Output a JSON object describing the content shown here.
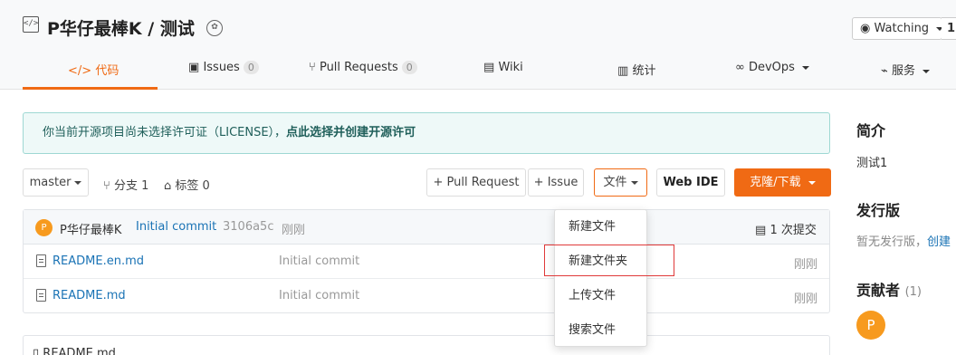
{
  "header": {
    "repo_title": "P华仔最棒K / 测试",
    "watch_label": "Watching",
    "watch_count": "1",
    "tabs": [
      {
        "icon": "</>",
        "label": "代码"
      },
      {
        "label": "Issues",
        "count": "0"
      },
      {
        "label": "Pull Requests",
        "count": "0"
      },
      {
        "label": "Wiki"
      },
      {
        "label": "统计"
      },
      {
        "label": "DevOps"
      },
      {
        "label": "服务"
      }
    ]
  },
  "notice": {
    "text": "你当前开源项目尚未选择许可证（LICENSE），",
    "link": "点此选择并创建开源许可"
  },
  "toolbar": {
    "branch": "master",
    "branches_label": "分支 1",
    "tags_label": "标签 0",
    "pull_request": "+ Pull Request",
    "issue": "+ Issue",
    "file": "文件",
    "web_ide": "Web IDE",
    "clone": "克隆/下载"
  },
  "commit": {
    "avatar": "P",
    "author": "P华仔最棒K",
    "message": "Initial commit",
    "hash": "3106a5c",
    "time": "刚刚",
    "commits_label": "1 次提交"
  },
  "files": [
    {
      "name": "README.en.md",
      "message": "Initial commit",
      "time": "刚刚"
    },
    {
      "name": "README.md",
      "message": "Initial commit",
      "time": "刚刚"
    }
  ],
  "dropdown": {
    "items": [
      "新建文件",
      "新建文件夹",
      "上传文件",
      "搜索文件"
    ]
  },
  "readme": {
    "title": "README.md"
  },
  "sidebar": {
    "intro_title": "简介",
    "intro_text": "测试1",
    "release_title": "发行版",
    "release_text": "暂无发行版，",
    "release_link": "创建",
    "contrib_title": "贡献者",
    "contrib_count": "(1)",
    "contrib_avatar": "P"
  },
  "colors": {
    "accent": "#f06a14",
    "link": "#1a73b5",
    "notice_bg": "#eef9f8",
    "highlight": "#e03a3a"
  }
}
